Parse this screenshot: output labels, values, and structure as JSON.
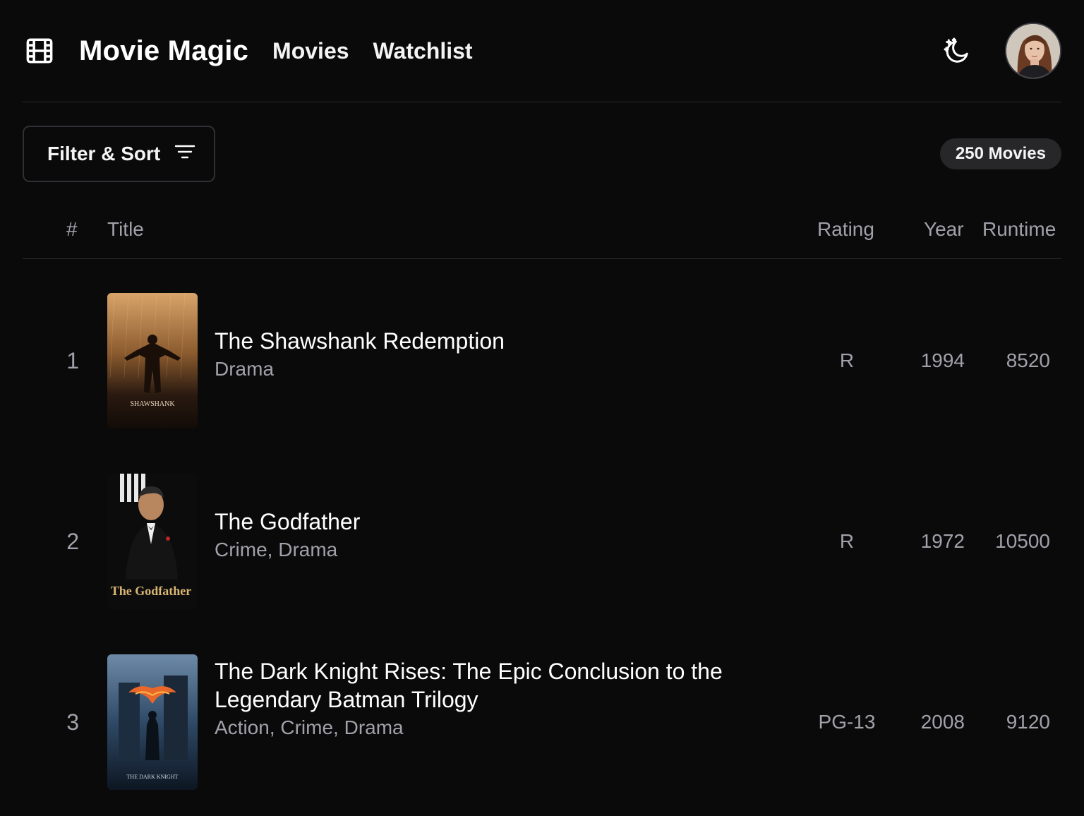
{
  "header": {
    "brand": "Movie Magic",
    "nav": [
      {
        "label": "Movies"
      },
      {
        "label": "Watchlist"
      }
    ],
    "logo_icon": "film-icon",
    "theme_icon": "moon-stars-icon"
  },
  "toolbar": {
    "filter_label": "Filter & Sort",
    "filter_icon": "filter-lines-icon",
    "count": "250 Movies"
  },
  "columns": {
    "rank": "#",
    "title": "Title",
    "rating": "Rating",
    "year": "Year",
    "runtime": "Runtime"
  },
  "movies": [
    {
      "rank": "1",
      "title": "The Shawshank Redemption",
      "genres": "Drama",
      "rating": "R",
      "year": "1994",
      "runtime": "8520",
      "poster_text": "SHAWSHANK"
    },
    {
      "rank": "2",
      "title": "The Godfather",
      "genres": "Crime, Drama",
      "rating": "R",
      "year": "1972",
      "runtime": "10500",
      "poster_text": "The Godfather"
    },
    {
      "rank": "3",
      "title": "The Dark Knight Rises: The Epic Conclusion to the Legendary Batman Trilogy",
      "genres": "Action, Crime, Drama",
      "rating": "PG-13",
      "year": "2008",
      "runtime": "9120",
      "poster_text": "THE DARK KNIGHT"
    }
  ],
  "colors": {
    "background": "#0a0a0b",
    "muted_text": "#a1a1aa",
    "border": "#2a2a2e",
    "badge_bg": "#27272a"
  }
}
